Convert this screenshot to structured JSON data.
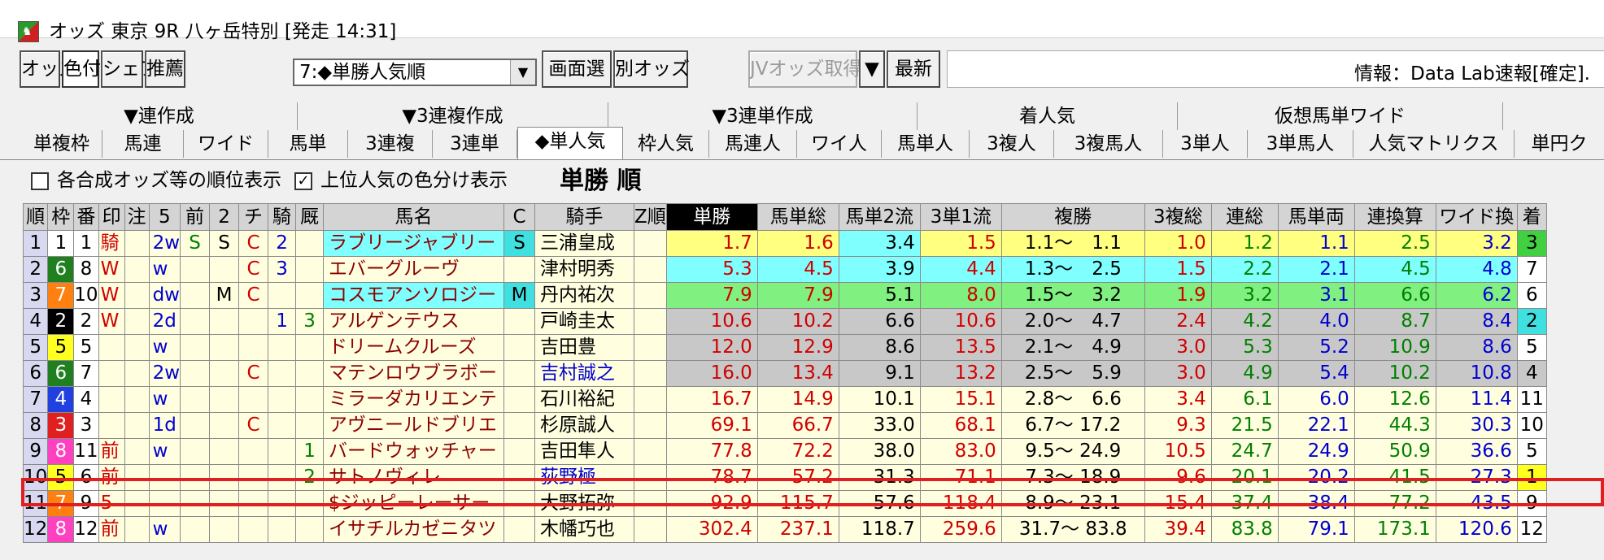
{
  "window": {
    "title": "オッズ 東京 9R 八ヶ岳特別 [発走 14:31]"
  },
  "toolbar": {
    "buttons": [
      "オッズ",
      "色付",
      "シェア",
      "推薦",
      "画面選",
      "別オッズ",
      "JVオッズ取得",
      "▼",
      "最新"
    ],
    "combo_value": "7:◆単勝人気順",
    "info": "情報：Data Lab速報[確定]."
  },
  "tabs_top": [
    "▼連作成",
    "▼3連複作成",
    "▼3連単作成",
    "着人気",
    "仮想馬単ワイド"
  ],
  "tabs_bottom": [
    "単複枠",
    "馬連",
    "ワイド",
    "馬単",
    "3連複",
    "3連単",
    "◆単人気",
    "枠人気",
    "馬連人",
    "ワイ人",
    "馬単人",
    "3複人",
    "3複馬人",
    "3単人",
    "3単馬人",
    "人気マトリクス",
    "単円ク"
  ],
  "options": {
    "rank_display": "各合成オッズ等の順位表示",
    "color_display": "上位人気の色分け表示"
  },
  "heading": "単勝 順",
  "colors": {
    "yellow": "#ffff80",
    "cyan": "#80ffff",
    "green": "#80f080",
    "gray": "#c8c8c8",
    "highlight": "#e02020"
  },
  "table": {
    "headers": [
      "順",
      "枠",
      "番",
      "印",
      "注",
      "5",
      "前",
      "2",
      "チ",
      "騎",
      "厩",
      "馬名",
      "C",
      "騎手",
      "Z順",
      "単勝",
      "馬単総",
      "馬単2流",
      "3単1流",
      "複勝",
      "3複総",
      "連総",
      "馬単両",
      "連換算",
      "ワイド換",
      "着"
    ],
    "rows": [
      {
        "rank": "1",
        "frame": "1",
        "num": "1",
        "mark": "騎",
        "note": "",
        "c5": "2w",
        "mae": "S",
        "c2": "S",
        "chi": "C",
        "ki": "2",
        "kyu": "",
        "name": "ラブリージャブリー",
        "cc": "S",
        "jockey": "三浦皇成",
        "z": "",
        "win": "1.7",
        "ut": "1.6",
        "u2": "3.4",
        "s1": "1.5",
        "fuku": "1.1〜　1.1",
        "f3": "1.0",
        "rs": "1.2",
        "ur": "1.1",
        "rk": "2.5",
        "wk": "3.2",
        "ch": "3"
      },
      {
        "rank": "2",
        "frame": "6",
        "num": "8",
        "mark": "W",
        "note": "",
        "c5": "w",
        "mae": "",
        "c2": "",
        "chi": "C",
        "ki": "3",
        "kyu": "",
        "name": "エバーグルーヴ",
        "cc": "",
        "jockey": "津村明秀",
        "z": "",
        "win": "5.3",
        "ut": "4.5",
        "u2": "3.9",
        "s1": "4.4",
        "fuku": "1.3〜　2.5",
        "f3": "1.5",
        "rs": "2.2",
        "ur": "2.1",
        "rk": "4.5",
        "wk": "4.8",
        "ch": "7"
      },
      {
        "rank": "3",
        "frame": "7",
        "num": "10",
        "mark": "W",
        "note": "",
        "c5": "dw",
        "mae": "",
        "c2": "M",
        "chi": "C",
        "ki": "",
        "kyu": "",
        "name": "コスモアンソロジー",
        "cc": "M",
        "jockey": "丹内祐次",
        "z": "",
        "win": "7.9",
        "ut": "7.9",
        "u2": "5.1",
        "s1": "8.0",
        "fuku": "1.5〜　3.2",
        "f3": "1.9",
        "rs": "3.2",
        "ur": "3.1",
        "rk": "6.6",
        "wk": "6.2",
        "ch": "6"
      },
      {
        "rank": "4",
        "frame": "2",
        "num": "2",
        "mark": "W",
        "note": "",
        "c5": "2d",
        "mae": "",
        "c2": "",
        "chi": "",
        "ki": "1",
        "kyu": "3",
        "name": "アルゲンテウス",
        "cc": "",
        "jockey": "戸崎圭太",
        "z": "",
        "win": "10.6",
        "ut": "10.2",
        "u2": "6.6",
        "s1": "10.6",
        "fuku": "2.0〜　4.7",
        "f3": "2.4",
        "rs": "4.2",
        "ur": "4.0",
        "rk": "8.7",
        "wk": "8.4",
        "ch": "2"
      },
      {
        "rank": "5",
        "frame": "5",
        "num": "5",
        "mark": "",
        "note": "",
        "c5": "w",
        "mae": "",
        "c2": "",
        "chi": "",
        "ki": "",
        "kyu": "",
        "name": "ドリームクルーズ",
        "cc": "",
        "jockey": "吉田豊",
        "z": "",
        "win": "12.0",
        "ut": "12.9",
        "u2": "8.6",
        "s1": "13.5",
        "fuku": "2.1〜　4.9",
        "f3": "3.0",
        "rs": "5.3",
        "ur": "5.2",
        "rk": "10.9",
        "wk": "8.6",
        "ch": "5"
      },
      {
        "rank": "6",
        "frame": "6",
        "num": "7",
        "mark": "",
        "note": "",
        "c5": "2w",
        "mae": "",
        "c2": "",
        "chi": "C",
        "ki": "",
        "kyu": "",
        "name": "マテンロウブラボー",
        "cc": "",
        "jockey": "吉村誠之",
        "z": "",
        "win": "16.0",
        "ut": "13.4",
        "u2": "9.1",
        "s1": "13.2",
        "fuku": "2.5〜　5.9",
        "f3": "3.0",
        "rs": "4.9",
        "ur": "5.4",
        "rk": "10.2",
        "wk": "10.8",
        "ch": "4"
      },
      {
        "rank": "7",
        "frame": "4",
        "num": "4",
        "mark": "",
        "note": "",
        "c5": "w",
        "mae": "",
        "c2": "",
        "chi": "",
        "ki": "",
        "kyu": "",
        "name": "ミラーダカリエンテ",
        "cc": "",
        "jockey": "石川裕紀",
        "z": "",
        "win": "16.7",
        "ut": "14.9",
        "u2": "10.1",
        "s1": "15.1",
        "fuku": "2.8〜　6.6",
        "f3": "3.4",
        "rs": "6.1",
        "ur": "6.0",
        "rk": "12.6",
        "wk": "11.4",
        "ch": "11"
      },
      {
        "rank": "8",
        "frame": "3",
        "num": "3",
        "mark": "",
        "note": "",
        "c5": "1d",
        "mae": "",
        "c2": "",
        "chi": "C",
        "ki": "",
        "kyu": "",
        "name": "アヴニールドブリエ",
        "cc": "",
        "jockey": "杉原誠人",
        "z": "",
        "win": "69.1",
        "ut": "66.7",
        "u2": "33.0",
        "s1": "68.1",
        "fuku": "6.7〜 17.2",
        "f3": "9.3",
        "rs": "21.5",
        "ur": "22.1",
        "rk": "44.3",
        "wk": "30.3",
        "ch": "10"
      },
      {
        "rank": "9",
        "frame": "8",
        "num": "11",
        "mark": "前",
        "note": "",
        "c5": "w",
        "mae": "",
        "c2": "",
        "chi": "",
        "ki": "",
        "kyu": "1",
        "name": "バードウォッチャー",
        "cc": "",
        "jockey": "吉田隼人",
        "z": "",
        "win": "77.8",
        "ut": "72.2",
        "u2": "38.0",
        "s1": "83.0",
        "fuku": "9.5〜 24.9",
        "f3": "10.5",
        "rs": "24.7",
        "ur": "24.9",
        "rk": "50.9",
        "wk": "36.6",
        "ch": "5"
      },
      {
        "rank": "10",
        "frame": "5",
        "num": "6",
        "mark": "前",
        "note": "",
        "c5": "",
        "mae": "",
        "c2": "",
        "chi": "",
        "ki": "",
        "kyu": "2",
        "name": "サトノヴィレ",
        "cc": "",
        "jockey": "荻野極",
        "z": "",
        "win": "78.7",
        "ut": "57.2",
        "u2": "31.3",
        "s1": "71.1",
        "fuku": "7.3〜 18.9",
        "f3": "9.6",
        "rs": "20.1",
        "ur": "20.2",
        "rk": "41.5",
        "wk": "27.3",
        "ch": "1"
      },
      {
        "rank": "11",
        "frame": "7",
        "num": "9",
        "mark": "5",
        "note": "",
        "c5": "",
        "mae": "",
        "c2": "",
        "chi": "",
        "ki": "",
        "kyu": "",
        "name": "$ジッピーレーサー",
        "cc": "",
        "jockey": "大野拓弥",
        "z": "",
        "win": "92.9",
        "ut": "115.7",
        "u2": "57.6",
        "s1": "118.4",
        "fuku": "8.9〜 23.1",
        "f3": "15.4",
        "rs": "37.4",
        "ur": "38.4",
        "rk": "77.2",
        "wk": "43.5",
        "ch": "9"
      },
      {
        "rank": "12",
        "frame": "8",
        "num": "12",
        "mark": "前",
        "note": "",
        "c5": "w",
        "mae": "",
        "c2": "",
        "chi": "",
        "ki": "",
        "kyu": "",
        "name": "イサチルカゼニタツ",
        "cc": "",
        "jockey": "木幡巧也",
        "z": "",
        "win": "302.4",
        "ut": "237.1",
        "u2": "118.7",
        "s1": "259.6",
        "fuku": "31.7〜 83.8",
        "f3": "39.4",
        "rs": "83.8",
        "ur": "79.1",
        "rk": "173.1",
        "wk": "120.6",
        "ch": "12"
      }
    ]
  }
}
